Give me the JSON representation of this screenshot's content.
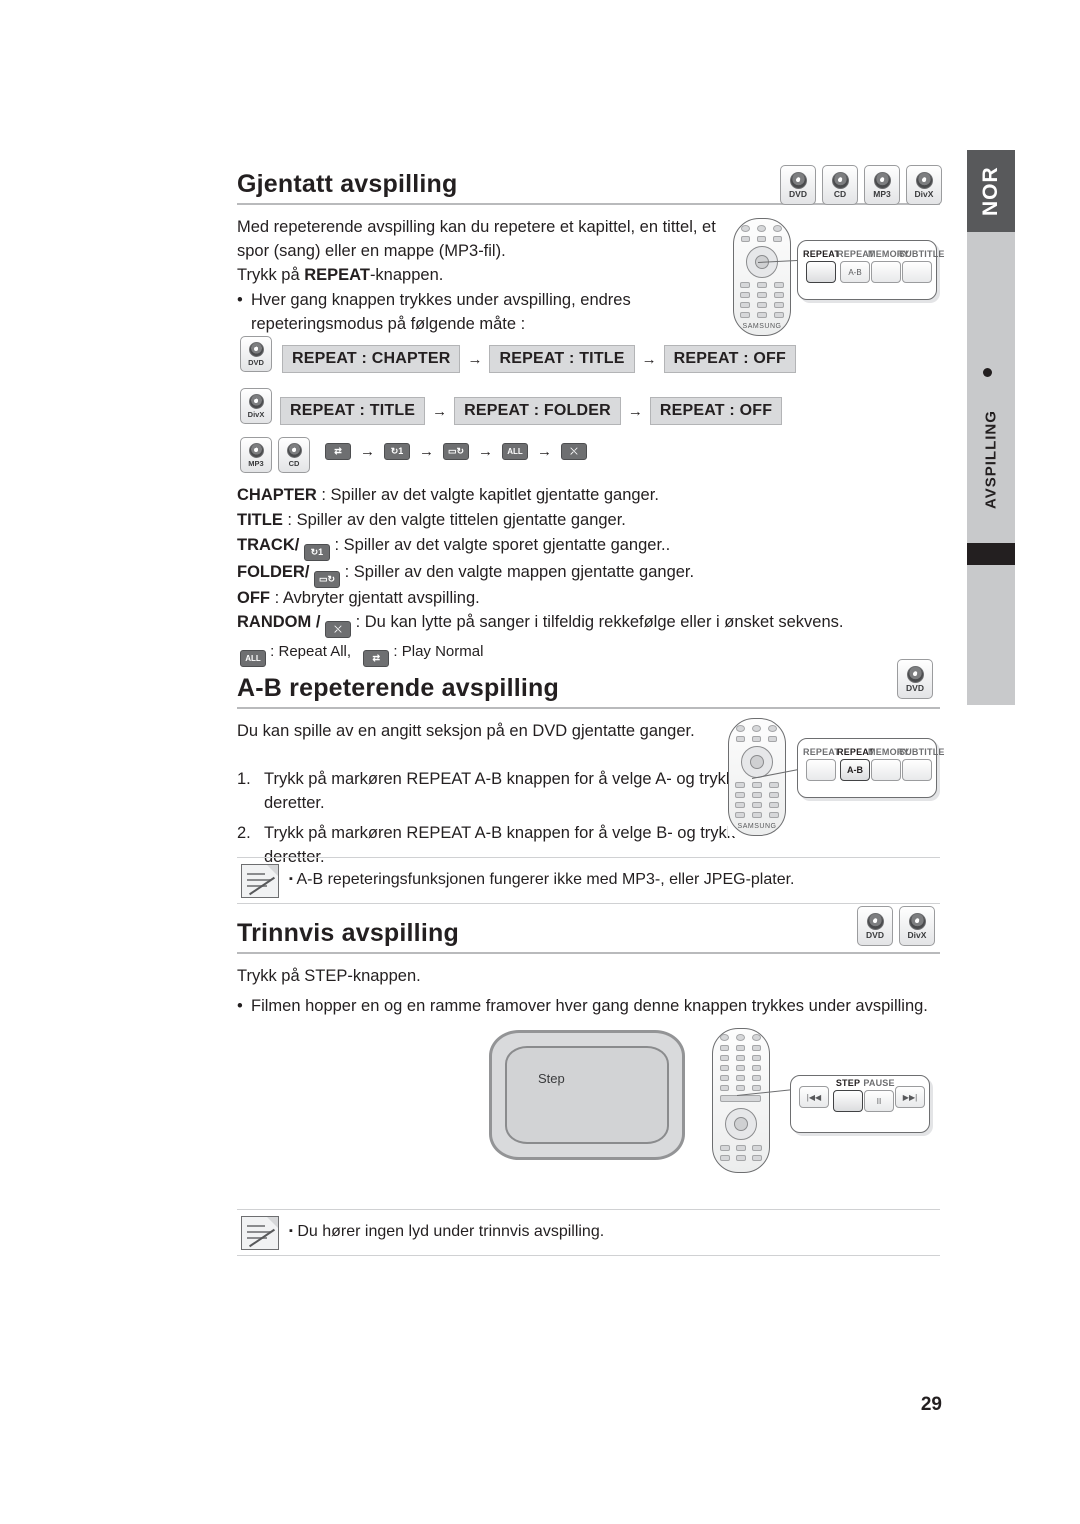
{
  "side": {
    "lang_tab": "NOR",
    "vertical_label": "AVSPILLING"
  },
  "page_number": "29",
  "sections": [
    {
      "title": "Gjentatt avspilling",
      "badges": [
        "DVD",
        "CD",
        "MP3",
        "DivX"
      ]
    },
    {
      "title": "A-B repeterende avspilling",
      "badges": [
        "DVD"
      ]
    },
    {
      "title": "Trinnvis avspilling",
      "badges": [
        "DVD",
        "DivX"
      ]
    }
  ],
  "repeat": {
    "intro_line1": "Med repeterende avspilling kan du repetere et kapittel, en tittel, et",
    "intro_line2": "spor (sang) eller en mappe (MP3-fil).",
    "intro_line3_pre": "Trykk på ",
    "intro_line3_bold": "REPEAT",
    "intro_line3_post": "-knappen.",
    "bullet_line1": "Hver gang knappen trykkes under avspilling, endres",
    "bullet_line2": "repeteringsmodus på følgende måte :",
    "flow_dvd": [
      "REPEAT : CHAPTER",
      "REPEAT : TITLE",
      "REPEAT : OFF"
    ],
    "flow_divx": [
      "REPEAT : TITLE",
      "REPEAT : FOLDER",
      "REPEAT :  OFF"
    ],
    "flow_audio_icons": [
      "repeat-icon",
      "track-icon",
      "folder-icon",
      "all-icon",
      "random-icon"
    ],
    "defs": [
      {
        "term": "CHAPTER",
        "text": " : Spiller av det valgte kapitlet gjentatte ganger."
      },
      {
        "term": "TITLE",
        "text": " : Spiller av den valgte tittelen gjentatte ganger."
      },
      {
        "term": "TRACK/",
        "icon": "track-icon",
        "text": " : Spiller av det valgte sporet gjentatte ganger.."
      },
      {
        "term": "FOLDER/",
        "icon": "folder-icon",
        "text": " : Spiller av den valgte mappen gjentatte ganger."
      },
      {
        "term": "OFF",
        "text": " : Avbryter gjentatt avspilling."
      },
      {
        "term": "RANDOM /",
        "icon": "random-icon",
        "text": " : Du kan lytte på sanger i tilfeldig rekkefølge eller i ønsket sekvens."
      }
    ],
    "legend_all": " : Repeat All,",
    "legend_normal": " : Play Normal"
  },
  "ab": {
    "intro": "Du kan spille av en angitt seksjon på en DVD gjentatte ganger.",
    "steps": [
      {
        "num": "1.",
        "l1": "Trykk på markøren REPEAT A-B knappen for å velge A- og trykk",
        "l2": "deretter."
      },
      {
        "num": "2.",
        "l1": "Trykk på markøren REPEAT A-B knappen for å velge B- og trykk",
        "l2": "deretter."
      }
    ],
    "note": "A-B repeteringsfunksjonen fungerer ikke med MP3-, eller JPEG-plater."
  },
  "step": {
    "line1": "Trykk på STEP-knappen.",
    "bullet": "Filmen hopper en og en ramme framover hver gang denne knappen trykkes under avspilling.",
    "tv_label": "Step",
    "note": "Du hører ingen lyd under trinnvis avspilling."
  },
  "callout_repeat": {
    "keys": [
      {
        "cap": "REPEAT",
        "box": "",
        "active": true
      },
      {
        "cap": "REPEAT",
        "box": "A-B",
        "active": false
      },
      {
        "cap": "MEMORY",
        "box": "",
        "active": false
      },
      {
        "cap": "SUBTITLE",
        "box": "",
        "active": false
      }
    ]
  },
  "callout_ab": {
    "keys": [
      {
        "cap": "REPEAT",
        "box": "",
        "active": false
      },
      {
        "cap": "REPEAT",
        "box": "A-B",
        "active": true
      },
      {
        "cap": "MEMORY",
        "box": "",
        "active": false
      },
      {
        "cap": "SUBTITLE",
        "box": "",
        "active": false
      }
    ]
  },
  "callout_step": {
    "keys": [
      {
        "cap": "",
        "box": "|◀◀",
        "active": false
      },
      {
        "cap": "STEP",
        "box": "",
        "active": true
      },
      {
        "cap": "PAUSE",
        "box": "II",
        "active": false
      },
      {
        "cap": "",
        "box": "▶▶|",
        "active": false
      }
    ]
  },
  "remote_brand": "SAMSUNG"
}
